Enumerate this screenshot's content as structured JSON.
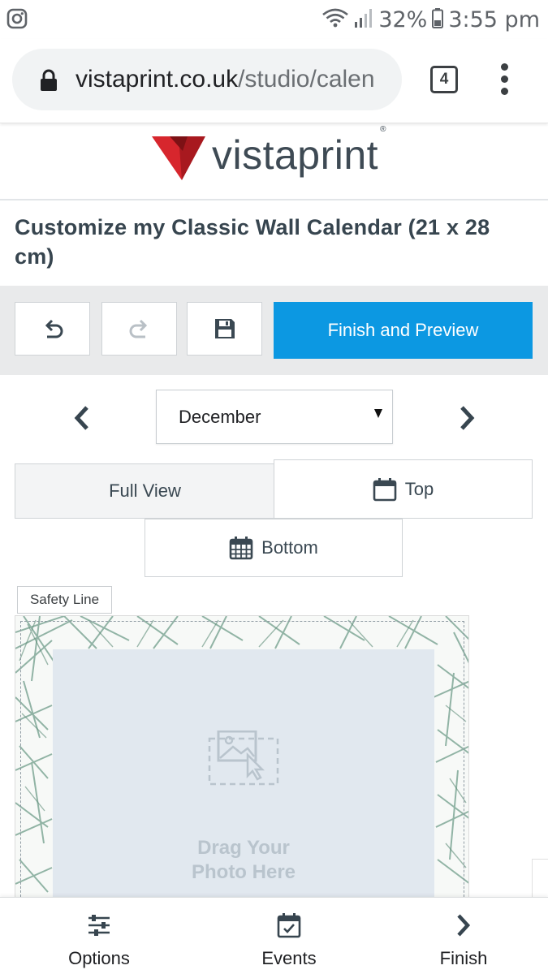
{
  "status_bar": {
    "battery": "32%",
    "time": "3:55 pm",
    "icons": [
      "instagram-icon",
      "wifi-icon",
      "signal-icon",
      "battery-icon"
    ]
  },
  "browser": {
    "url_host": "vistaprint.co.uk",
    "url_path": "/studio/calen",
    "tab_count": "4"
  },
  "brand": {
    "name": "vistaprint",
    "trademark": "®",
    "colors": {
      "red": "#d7262d",
      "dark_red": "#a8191f",
      "text": "#3e4a54"
    }
  },
  "page": {
    "title": "Customize my Classic Wall Calendar (21 x 28 cm)"
  },
  "toolbar": {
    "finish_preview_label": "Finish and Preview",
    "accent": "#0c98e2"
  },
  "month_picker": {
    "selected": "December"
  },
  "views": {
    "full_view": "Full View",
    "top": "Top",
    "bottom": "Bottom"
  },
  "canvas": {
    "safety_line_label": "Safety Line",
    "drop_text_line1": "Drag Your",
    "drop_text_line2": "Photo Here"
  },
  "bottom_nav": {
    "options": "Options",
    "events": "Events",
    "finish": "Finish"
  }
}
